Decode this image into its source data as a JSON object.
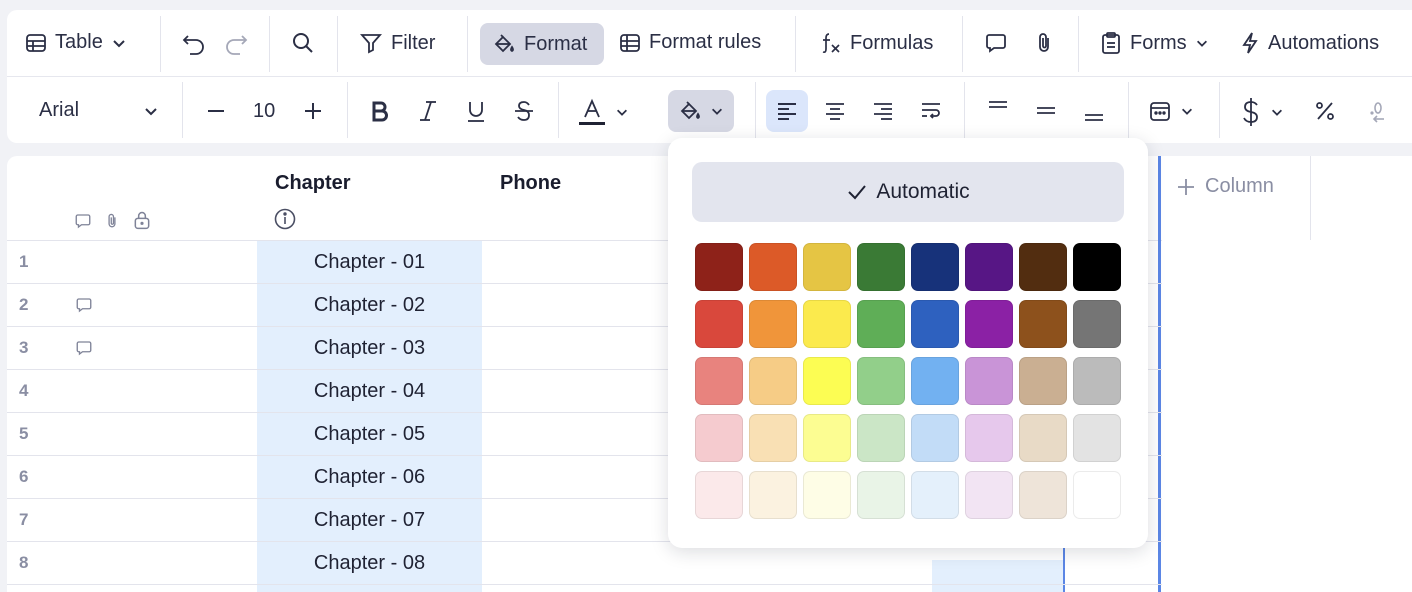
{
  "toolbar": {
    "table_label": "Table",
    "filter_label": "Filter",
    "format_label": "Format",
    "format_rules_label": "Format rules",
    "formulas_label": "Formulas",
    "forms_label": "Forms",
    "automations_label": "Automations",
    "font_name": "Arial",
    "font_size": "10"
  },
  "grid": {
    "columns": {
      "chapter": "Chapter",
      "phone": "Phone",
      "add_column": "Column"
    },
    "rows": [
      {
        "num": "1",
        "chapter": "Chapter - 01",
        "has_comment": false
      },
      {
        "num": "2",
        "chapter": "Chapter - 02",
        "has_comment": true
      },
      {
        "num": "3",
        "chapter": "Chapter - 03",
        "has_comment": true
      },
      {
        "num": "4",
        "chapter": "Chapter - 04",
        "has_comment": false
      },
      {
        "num": "5",
        "chapter": "Chapter - 05",
        "has_comment": false
      },
      {
        "num": "6",
        "chapter": "Chapter - 06",
        "has_comment": false
      },
      {
        "num": "7",
        "chapter": "Chapter - 07",
        "has_comment": false
      },
      {
        "num": "8",
        "chapter": "Chapter - 08",
        "has_comment": false
      }
    ]
  },
  "color_popup": {
    "automatic_label": "Automatic",
    "palette": [
      [
        "#8e2219",
        "#dc5a28",
        "#e5c544",
        "#3a7a35",
        "#17327a",
        "#571685",
        "#522d10",
        "#000000"
      ],
      [
        "#d9483c",
        "#f0953a",
        "#fbea4d",
        "#5fae57",
        "#2e61bf",
        "#8b21a5",
        "#8d511c",
        "#757575"
      ],
      [
        "#e8837e",
        "#f6cc86",
        "#fcfd53",
        "#92cf8a",
        "#72b1f1",
        "#c994d7",
        "#caaf92",
        "#bbbbbb"
      ],
      [
        "#f5cbcf",
        "#f9e0b4",
        "#fcfd92",
        "#cbe6c6",
        "#c2dcf7",
        "#e6c8ec",
        "#e8dac6",
        "#e3e3e3"
      ],
      [
        "#fbe9ea",
        "#fbf2e0",
        "#fefde6",
        "#e9f4e7",
        "#e4f0fb",
        "#f2e4f3",
        "#eee4d9",
        "#ffffff"
      ]
    ]
  }
}
